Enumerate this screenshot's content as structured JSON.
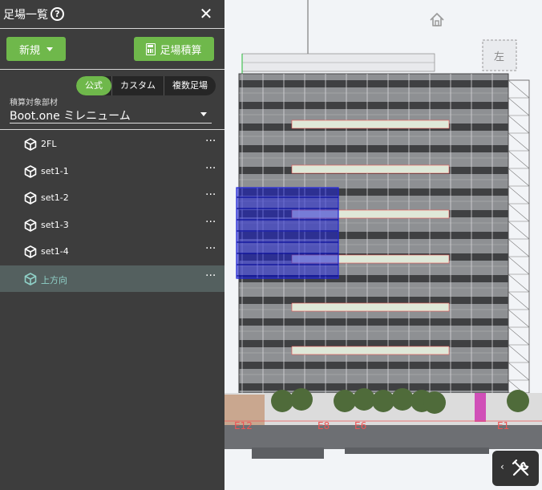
{
  "panel": {
    "title": "足場一覧",
    "help_glyph": "?",
    "close_glyph": "✕",
    "new_button": "新規",
    "calc_button": "足場積算",
    "modes": [
      "公式",
      "カスタム",
      "複数足場"
    ],
    "active_mode": "公式",
    "target_label": "積算対象部材",
    "target_value": "Boot.one ミレニューム",
    "items": [
      {
        "label": "2FL",
        "selected": false
      },
      {
        "label": "set1-1",
        "selected": false
      },
      {
        "label": "set1-2",
        "selected": false
      },
      {
        "label": "set1-3",
        "selected": false
      },
      {
        "label": "set1-4",
        "selected": false
      },
      {
        "label": "上方向",
        "selected": true
      }
    ],
    "more_glyph": "···"
  },
  "viewport": {
    "view_cube_face": "左",
    "grid_labels": [
      "E12",
      "E8",
      "E6",
      "E1"
    ],
    "tools_arrow": "‹",
    "colors": {
      "scaffold": "#3a3a3a",
      "facade": "#8e9093",
      "selection": "#1f23d6",
      "accent_green": "#6fb84b",
      "grid_red": "#e55"
    }
  },
  "colors": {
    "panel_bg": "#3d3d3d",
    "selected_row": "#54605f",
    "selected_text": "#8fd0c7"
  }
}
